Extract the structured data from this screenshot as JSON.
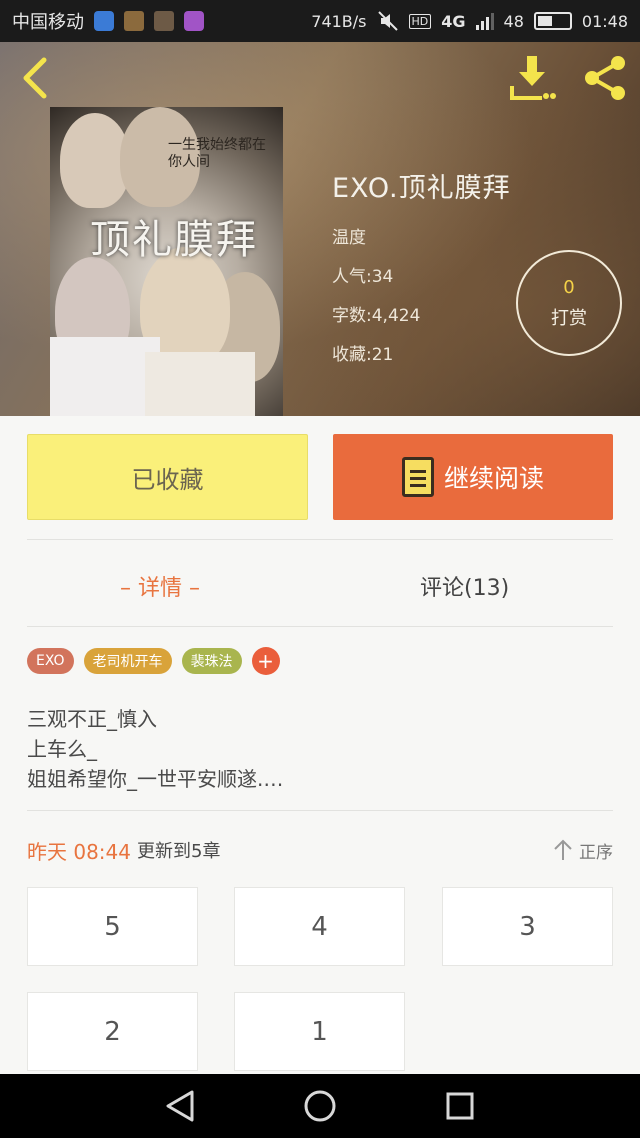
{
  "status_bar": {
    "carrier": "中国移动",
    "net_speed": "741B/s",
    "network": "4G",
    "signal_level": 0.75,
    "battery_percent": "48",
    "battery_level": 0.48,
    "time": "01:48"
  },
  "book": {
    "title": "EXO.顶礼膜拜",
    "author": "温度",
    "popularity": "人气:34",
    "word_count": "字数:4,424",
    "favorites": "收藏:21",
    "cover_title": "顶礼膜拜",
    "cover_subtitle": "一生我始终都在你人间"
  },
  "tip": {
    "count": "0",
    "label": "打赏"
  },
  "actions": {
    "favorited_label": "已收藏",
    "read_label": "继续阅读"
  },
  "tabs": {
    "details": "– 详情 –",
    "comments": "评论(13)"
  },
  "tags": [
    {
      "label": "EXO",
      "color": "#d2745c"
    },
    {
      "label": "老司机开车",
      "color": "#d9a33a"
    },
    {
      "label": "裴珠法",
      "color": "#a9b54e"
    }
  ],
  "tag_add": "+",
  "synopsis": {
    "line1": "三观不正_慎入",
    "line2": "上车么_",
    "line3": "姐姐希望你_一世平安顺遂.…"
  },
  "update": {
    "time": "昨天 08:44",
    "text": "更新到5章",
    "sort_label": "正序"
  },
  "chapters": [
    "5",
    "4",
    "3",
    "2",
    "1"
  ],
  "colors": {
    "accent": "#e8743f",
    "favorited_bg": "#faf07a",
    "read_bg": "#e96b3d"
  }
}
